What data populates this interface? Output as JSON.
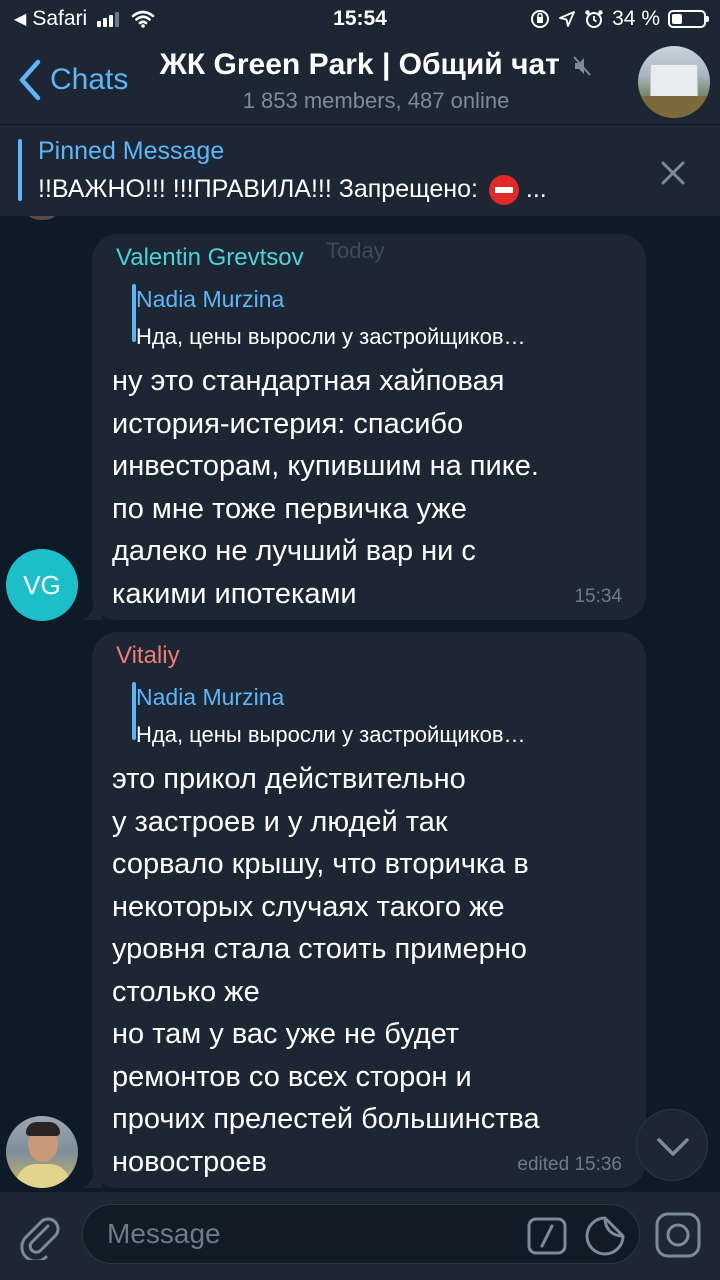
{
  "status_bar": {
    "back_app": "Safari",
    "time": "15:54",
    "battery": "34 %",
    "battery_level": 0.34
  },
  "header": {
    "back_label": "Chats",
    "title": "ЖК Green Park | Общий чат",
    "subtitle": "1 853 members, 487 online"
  },
  "pinned": {
    "title": "Pinned Message",
    "text": "!!ВАЖНО!!! !!!ПРАВИЛА!!! Запрещено:",
    "ellipsis": "..."
  },
  "date_label": "Today",
  "messages": [
    {
      "sender": "Valentin Grevtsov",
      "sender_color": "#4fd1d9",
      "avatar_initials": "VG",
      "avatar_color": "#1bbfc8",
      "reply": {
        "name": "Nadia Murzina",
        "text": "Нда, цены выросли у застройщиков…"
      },
      "text": "ну это стандартная хайповая\nистория-истерия: спасибо\nинвесторам, купившим на пике.\nпо мне тоже первичка уже\nдалеко не лучший вар ни с\nкакими ипотеками",
      "time": "15:34"
    },
    {
      "sender": "Vitaliy",
      "sender_color": "#f07e76",
      "reply": {
        "name": "Nadia Murzina",
        "text": "Нда, цены выросли у застройщиков…"
      },
      "text": "это прикол действительно\nу застроев и у людей так\nсорвало крышу, что вторичка в\nнекоторых случаях такого же\nуровня стала стоить примерно\nстолько же\nно там у вас уже не будет\nремонтов со всех сторон и\nпрочих прелестей большинства\nновостроев",
      "time": "edited 15:36"
    }
  ],
  "input": {
    "placeholder": "Message"
  },
  "colors": {
    "accent": "#5eb5f7",
    "background": "#0f1a27",
    "bar": "#1d2733",
    "bubble": "#1c2733"
  }
}
